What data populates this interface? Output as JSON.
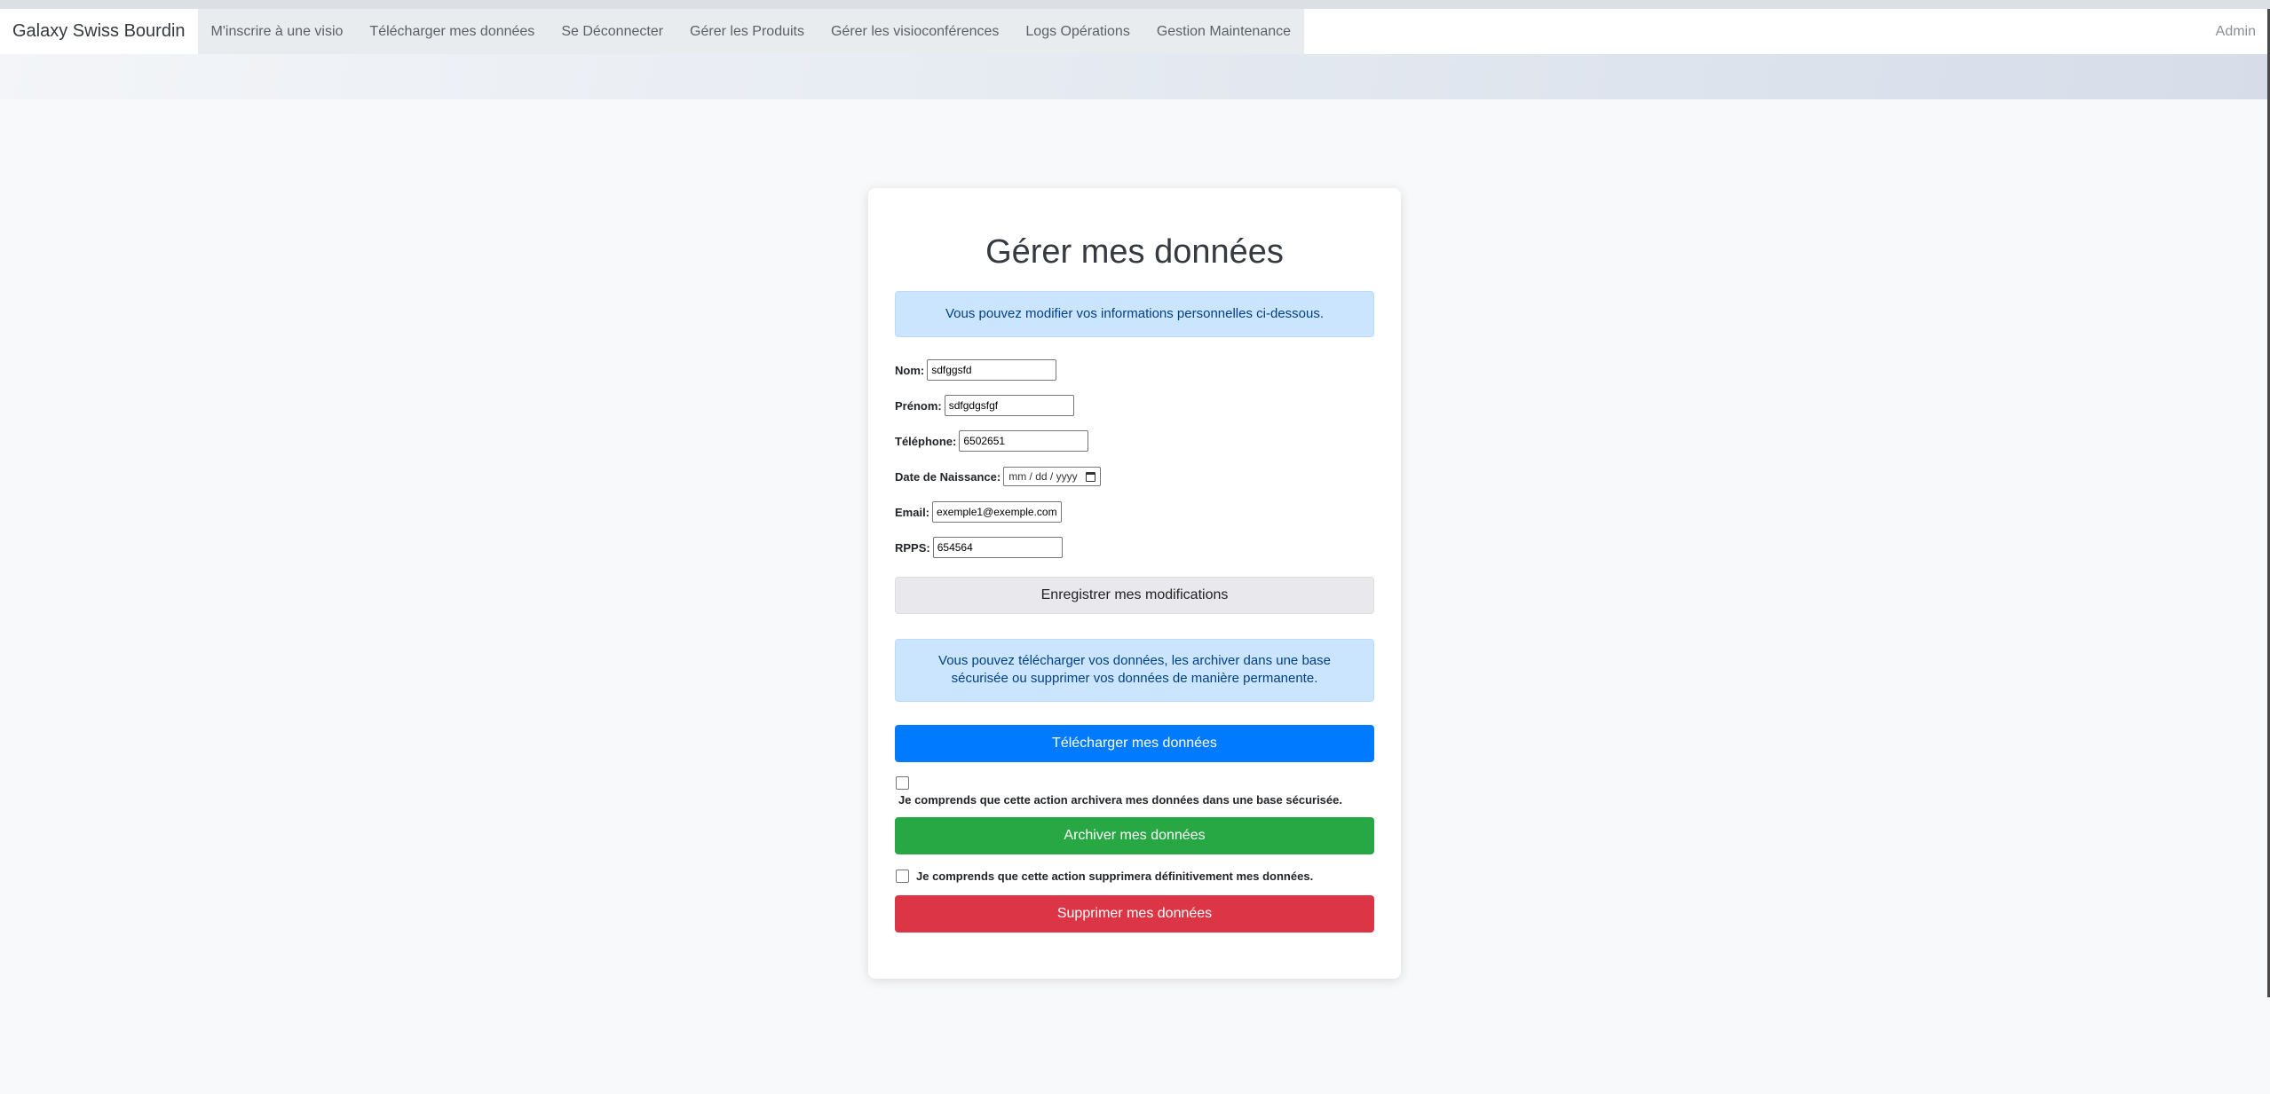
{
  "navbar": {
    "brand": "Galaxy Swiss Bourdin",
    "links": [
      "M'inscrire à une visio",
      "Télécharger mes données",
      "Se Déconnecter",
      "Gérer les Produits",
      "Gérer les visioconférences",
      "Logs Opérations",
      "Gestion Maintenance"
    ],
    "right": "Admin"
  },
  "card": {
    "title": "Gérer mes données",
    "info_edit": "Vous pouvez modifier vos informations personnelles ci-dessous.",
    "fields": {
      "nom": {
        "label": "Nom:",
        "value": "sdfggsfd"
      },
      "prenom": {
        "label": "Prénom:",
        "value": "sdfgdgsfgf"
      },
      "telephone": {
        "label": "Téléphone:",
        "value": "6502651"
      },
      "naissance": {
        "label": "Date de Naissance:",
        "placeholder": "mm / dd / yyyy"
      },
      "email": {
        "label": "Email:",
        "value": "exemple1@exemple.com"
      },
      "rpps": {
        "label": "RPPS:",
        "value": "654564"
      }
    },
    "save_label": "Enregistrer mes modifications",
    "info_data": "Vous pouvez télécharger vos données, les archiver dans une base sécurisée ou supprimer vos données de manière permanente.",
    "download_label": "Télécharger mes données",
    "archive_consent": "Je comprends que cette action archivera mes données dans une base sécurisée.",
    "archive_label": "Archiver mes données",
    "delete_consent": "Je comprends que cette action supprimera définitivement mes données.",
    "delete_label": "Supprimer mes données"
  }
}
